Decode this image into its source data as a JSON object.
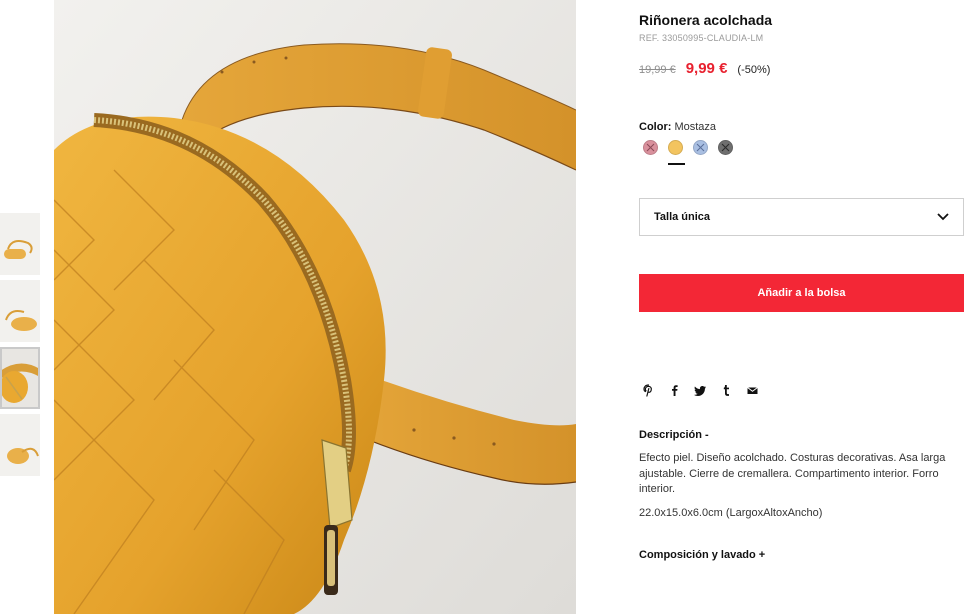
{
  "product": {
    "title": "Riñonera acolchada",
    "ref": "REF. 33050995-CLAUDIA-LM",
    "old_price": "19,99 €",
    "new_price": "9,99 €",
    "discount": "(-50%)"
  },
  "color": {
    "label": "Color:",
    "selected": "Mostaza",
    "swatches": [
      {
        "name": "pink",
        "hex": "#d9909c"
      },
      {
        "name": "mustard",
        "hex": "#f3c45f"
      },
      {
        "name": "light-blue",
        "hex": "#a9bfe2"
      },
      {
        "name": "dark-grey",
        "hex": "#6f6f6f"
      }
    ]
  },
  "size": {
    "selected": "Talla única"
  },
  "cart": {
    "add_label": "Añadir a la bolsa",
    "accent": "#f32736"
  },
  "share_icons": [
    "pinterest-icon",
    "facebook-icon",
    "twitter-icon",
    "tumblr-icon",
    "email-icon"
  ],
  "description": {
    "heading": "Descripción -",
    "text": "Efecto piel. Diseño acolchado. Costuras decorativas. Asa larga ajustable. Cierre de cremallera. Compartimento interior. Forro interior.",
    "dimensions": "22.0x15.0x6.0cm (LargoxAltoxAncho)"
  },
  "composition": {
    "heading": "Composición y lavado +"
  }
}
